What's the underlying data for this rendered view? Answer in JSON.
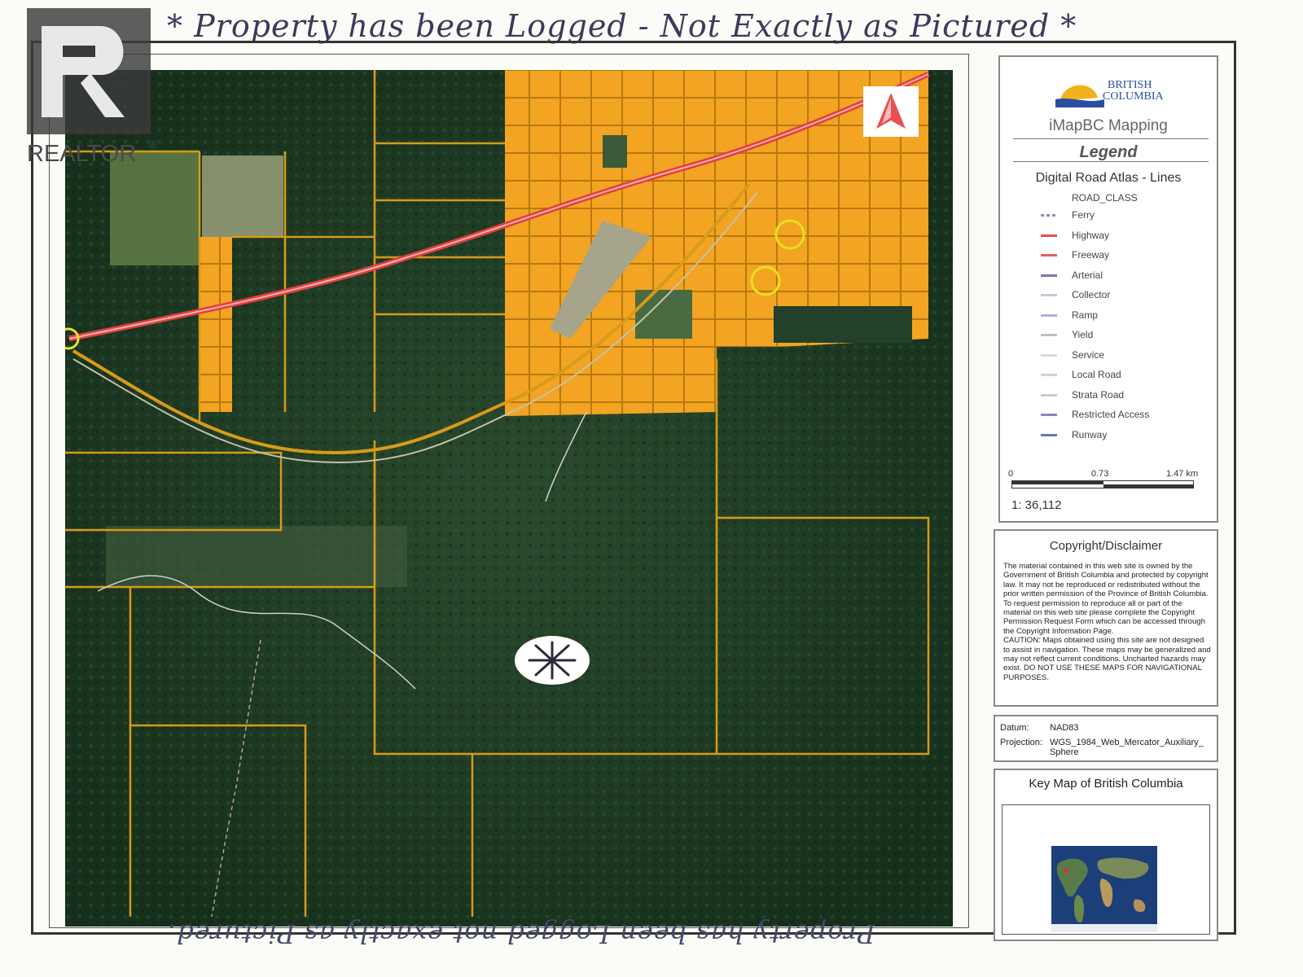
{
  "top_note": "* Property has been Logged - Not Exactly as Pictured *",
  "bottom_note": "Property has been Logged not exactly as Pictured.",
  "realtor": {
    "name": "REALTOR",
    "mark": "®"
  },
  "bc_logo": {
    "line1": "BRITISH",
    "line2": "COLUMBIA"
  },
  "legend": {
    "app_title": "iMapBC Mapping",
    "heading": "Legend",
    "layer": "Digital Road Atlas - Lines",
    "class_heading": "ROAD_CLASS",
    "items": [
      {
        "label": "Ferry",
        "color": "#8a8ac8"
      },
      {
        "label": "Highway",
        "color": "#e05050"
      },
      {
        "label": "Freeway",
        "color": "#e06060"
      },
      {
        "label": "Arterial",
        "color": "#7878b8"
      },
      {
        "label": "Collector",
        "color": "#c8c8d8"
      },
      {
        "label": "Ramp",
        "color": "#b0b0d8"
      },
      {
        "label": "Yield",
        "color": "#c0c0c0"
      },
      {
        "label": "Service",
        "color": "#d8d8e0"
      },
      {
        "label": "Local Road",
        "color": "#d0d0d8"
      },
      {
        "label": "Strata Road",
        "color": "#c8c8d0"
      },
      {
        "label": "Restricted Access",
        "color": "#8888b8"
      },
      {
        "label": "Runway",
        "color": "#6a78b0"
      }
    ],
    "scale": {
      "ticks": [
        "0",
        "0.73",
        "1.47 km"
      ],
      "ratio": "1: 36,112"
    }
  },
  "disclaimer": {
    "title": "Copyright/Disclaimer",
    "body": "The material contained in this web site is owned by the Government of British Columbia and protected by copyright law. It may not be reproduced or redistributed without the prior written permission of the Province of British Columbia. To request permission to reproduce all or part of the material on this web site please complete the Copyright Permission Request Form which can be accessed through the Copyright Information Page.",
    "caution": "CAUTION: Maps obtained using this site are not designed to assist in navigation. These maps may be generalized and may not reflect current conditions. Uncharted hazards may exist. DO NOT USE THESE MAPS FOR NAVIGATIONAL PURPOSES."
  },
  "datum": {
    "datum_label": "Datum:",
    "datum_value": "NAD83",
    "projection_label": "Projection:",
    "projection_value": "WGS_1984_Web_Mercator_Auxiliary_Sphere"
  },
  "keymap": {
    "title": "Key Map of British Columbia"
  },
  "colors": {
    "parcel": "#f0a020",
    "parcel_line": "#d89a18",
    "forest": "#1f3a24",
    "highway": "#e04040",
    "marker": "#e8e020"
  }
}
